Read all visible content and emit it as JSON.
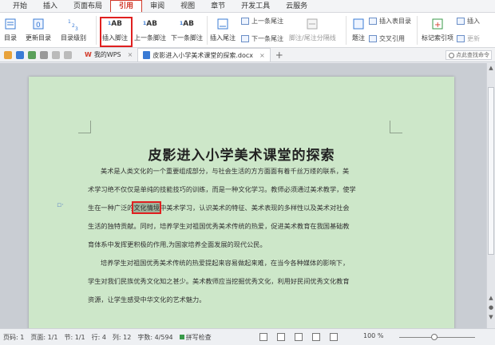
{
  "menu": {
    "tabs": [
      "开始",
      "插入",
      "页面布局",
      "引用",
      "审阅",
      "视图",
      "章节",
      "开发工具",
      "云服务"
    ],
    "active": "引用"
  },
  "ribbon": {
    "toc_label": "目录",
    "update_toc": "更新目录",
    "toc_level": "目录级别",
    "insert_footnote": "插入脚注",
    "prev_footnote": "上一条脚注",
    "next_footnote": "下一条脚注",
    "insert_endnote": "插入尾注",
    "next_endnote": "下一条尾注",
    "endnote_separator": "脚注/尾注分隔线",
    "caption": "题注",
    "cross_ref": "交叉引用",
    "insert_toa": "插入表目录",
    "mark_index": "标记索引项",
    "insert_index": "插入",
    "update_index": "更新"
  },
  "tabbar": {
    "wps_tab": "我的WPS",
    "doc_tab": "皮影进入小学美术课堂的探索.docx",
    "search_placeholder": "点此查找命令"
  },
  "document": {
    "title": "皮影进入小学美术课堂的探索",
    "lines": [
      "美术是人类文化的一个重要组成部分，与社会生活的方方面面有着千丝万缕的联系，美",
      "术学习绝不仅仅是单纯的技能技巧的训练，而是一种文化学习。教师必须通过美术教学，使学",
      "中美术学习，认识美术的特征、美术表现的多样性以及美术对社会",
      "生活的独特贡献。同时，培养学生对祖国优秀美术传统的热爱，促进美术教育在我国基础教",
      "育体系中发挥更积极的作用,为国家培养全面发展的现代公民。",
      "培养学生对祖国优秀美术传统的热爱提起来容易做起来难，在当今各种媒体的影响下，",
      "学生对我们民族优秀文化知之甚少。美术教师应当挖掘优秀文化，利用好民间优秀文化教育",
      "资源，让学生感受中华文化的艺术魅力。"
    ],
    "line3_prefix": "生在一种广泛的",
    "highlight": "文化情境"
  },
  "status": {
    "page_no": "页码: 1",
    "pages": "页面: 1/1",
    "section": "节: 1/1",
    "row": "行: 4",
    "col": "列: 12",
    "words": "字数: 4/594",
    "spell": "拼写检查",
    "zoom": "100 %"
  }
}
